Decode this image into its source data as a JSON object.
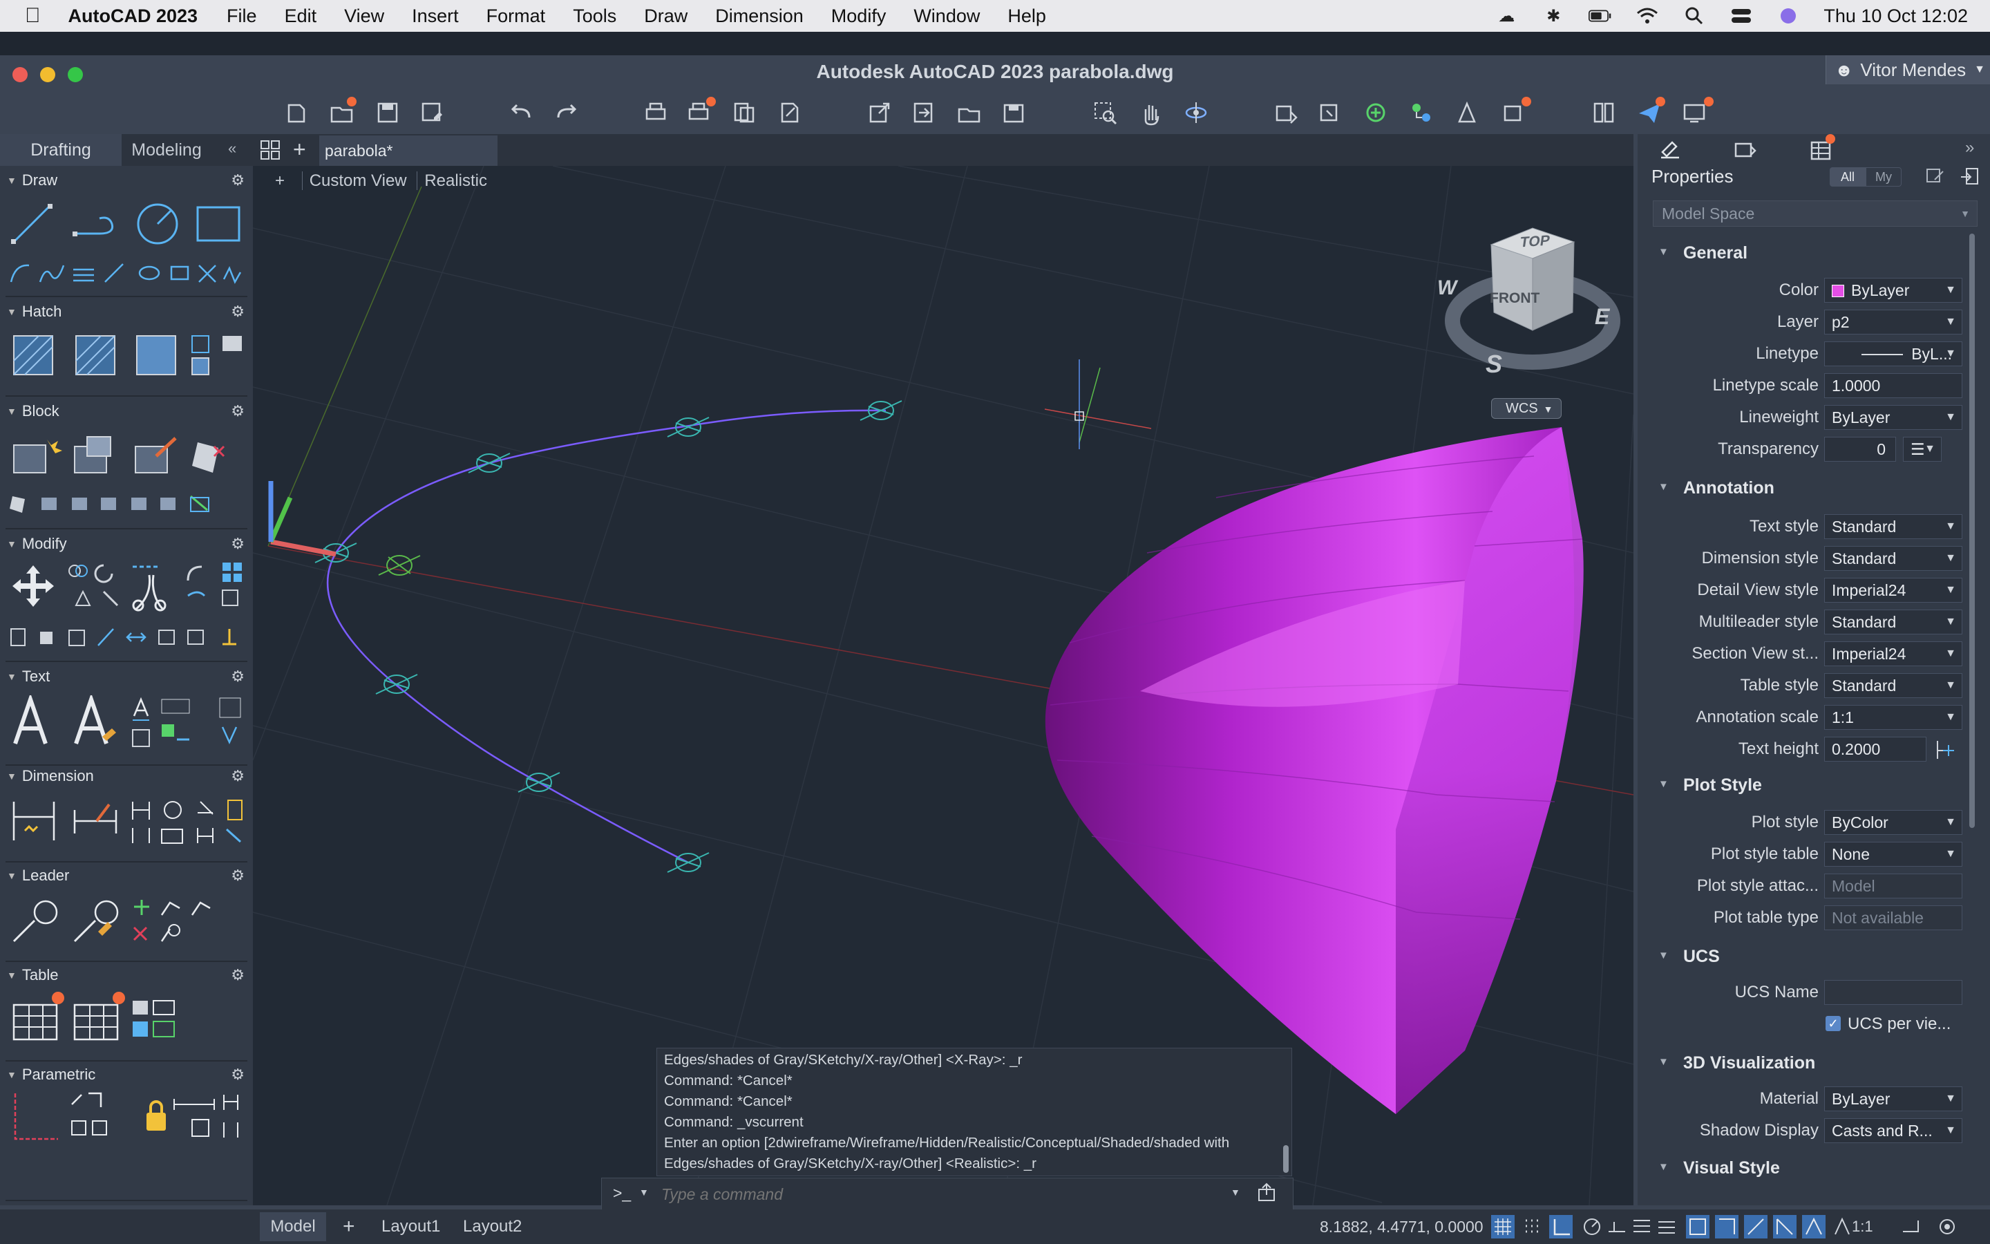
{
  "menubar": {
    "app_name": "AutoCAD 2023",
    "items": [
      "File",
      "Edit",
      "View",
      "Insert",
      "Format",
      "Tools",
      "Draw",
      "Dimension",
      "Modify",
      "Window",
      "Help"
    ],
    "clock": "Thu 10 Oct  12:02"
  },
  "window": {
    "title": "Autodesk AutoCAD 2023    parabola.dwg",
    "user": "Vitor Mendes"
  },
  "palette": {
    "tabs": [
      "Drafting",
      "Modeling"
    ],
    "sections": [
      "Draw",
      "Hatch",
      "Block",
      "Modify",
      "Text",
      "Dimension",
      "Leader",
      "Table",
      "Parametric"
    ]
  },
  "document": {
    "tab": "parabola*",
    "view_label": "Custom View",
    "visual_style": "Realistic",
    "wcs_label": "WCS"
  },
  "viewcube": {
    "top": "TOP",
    "front": "FRONT",
    "w": "W",
    "e": "E",
    "s": "S"
  },
  "properties": {
    "title": "Properties",
    "filter_all": "All",
    "filter_my": "My",
    "scope": "Model Space",
    "groups": {
      "general": "General",
      "annotation": "Annotation",
      "plot": "Plot Style",
      "ucs": "UCS",
      "viz": "3D Visualization",
      "visual": "Visual Style"
    },
    "general": [
      {
        "label": "Color",
        "value": "ByLayer"
      },
      {
        "label": "Layer",
        "value": "p2"
      },
      {
        "label": "Linetype",
        "value": "ByL..."
      },
      {
        "label": "Linetype scale",
        "value": "1.0000"
      },
      {
        "label": "Lineweight",
        "value": "ByLayer"
      },
      {
        "label": "Transparency",
        "value": "0"
      }
    ],
    "annotation": [
      {
        "label": "Text style",
        "value": "Standard"
      },
      {
        "label": "Dimension style",
        "value": "Standard"
      },
      {
        "label": "Detail View style",
        "value": "Imperial24"
      },
      {
        "label": "Multileader style",
        "value": "Standard"
      },
      {
        "label": "Section View st...",
        "value": "Imperial24"
      },
      {
        "label": "Table style",
        "value": "Standard"
      },
      {
        "label": "Annotation scale",
        "value": "1:1"
      },
      {
        "label": "Text height",
        "value": "0.2000"
      }
    ],
    "plot": [
      {
        "label": "Plot style",
        "value": "ByColor"
      },
      {
        "label": "Plot style table",
        "value": "None"
      },
      {
        "label": "Plot style attac...",
        "value": "Model"
      },
      {
        "label": "Plot table type",
        "value": "Not available"
      }
    ],
    "ucs": {
      "name_label": "UCS Name",
      "name_value": "",
      "per_view": "UCS per vie..."
    },
    "viz": [
      {
        "label": "Material",
        "value": "ByLayer"
      },
      {
        "label": "Shadow Display",
        "value": "Casts and R..."
      }
    ]
  },
  "command": {
    "history": [
      "Edges/shades of Gray/SKetchy/X-ray/Other] <X-Ray>: _r",
      "Command: *Cancel*",
      "Command: *Cancel*",
      "Command: _vscurrent",
      "Enter an option [2dwireframe/Wireframe/Hidden/Realistic/Conceptual/Shaded/shaded with",
      "Edges/shades of Gray/SKetchy/X-ray/Other] <Realistic>: _r"
    ],
    "prompt": ">_",
    "placeholder": "Type a command"
  },
  "status": {
    "tabs": [
      "Model",
      "Layout1",
      "Layout2"
    ],
    "coords": "8.1882, 4.4771, 0.0000",
    "scale": "1:1"
  },
  "colors": {
    "accent": "#c12ee0",
    "curve": "#7b5cff",
    "bg": "#222a35"
  }
}
